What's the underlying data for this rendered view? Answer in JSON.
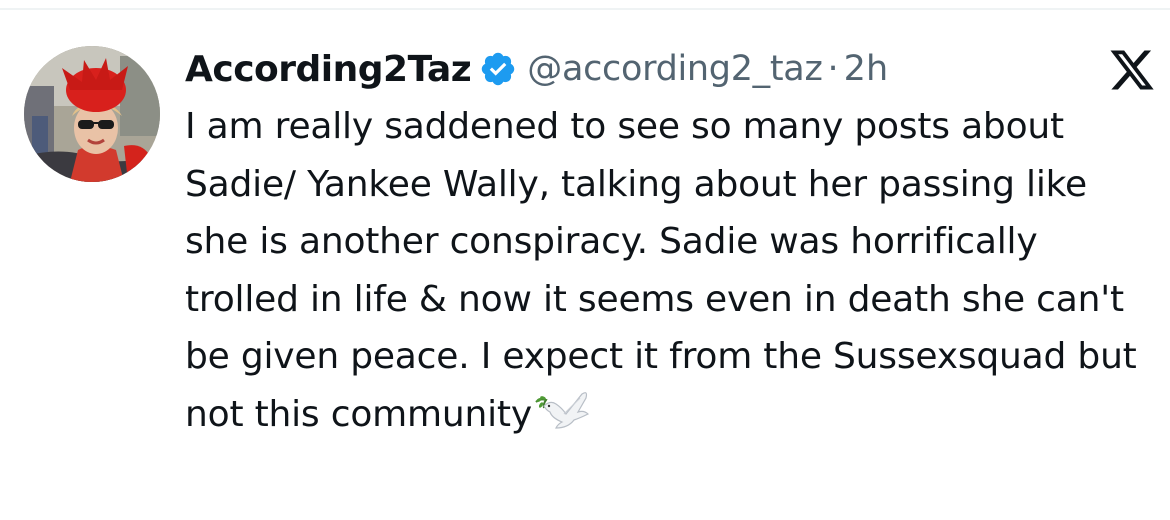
{
  "tweet": {
    "display_name": "According2Taz",
    "handle": "@according2_taz",
    "separator": "·",
    "time": "2h",
    "verified": true,
    "text": "I am really saddened to see so many posts about Sadie/ Yankee Wally, talking about her passing like she is another conspiracy. Sadie was horrifically trolled in life & now it seems even in death she can't be given peace. I expect it from the Sussexsquad but not this community",
    "emoji_icon": "dove-of-peace"
  },
  "icons": {
    "avatar": "profile-photo-woman-red-hat-sunglasses",
    "verified": "verified-badge-icon",
    "brand": "x-logo-icon"
  },
  "colors": {
    "verified_blue": "#1d9bf0",
    "text_primary": "#0f1419",
    "text_secondary": "#536471",
    "avatar_accent": "#d4231c"
  }
}
